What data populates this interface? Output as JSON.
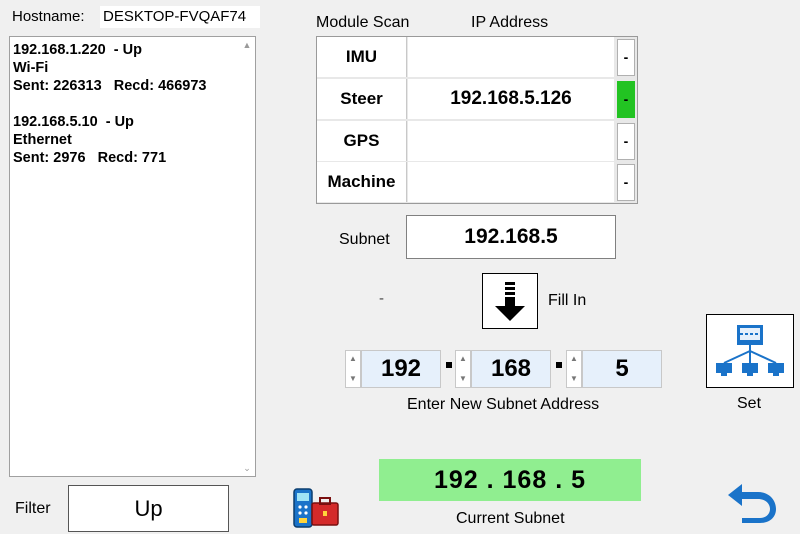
{
  "hostname": {
    "label": "Hostname:",
    "value": "DESKTOP-FVQAF74"
  },
  "networks": [
    {
      "address": "192.168.1.220  - Up",
      "type": "Wi-Fi",
      "traffic": "Sent: 226313   Recd: 466973"
    },
    {
      "address": "192.168.5.10  - Up",
      "type": "Ethernet",
      "traffic": "Sent: 2976   Recd: 771"
    }
  ],
  "filter": {
    "label": "Filter",
    "value": "Up"
  },
  "module_table": {
    "col_module": "Module Scan",
    "col_ip": "IP Address",
    "rows": [
      {
        "name": "IMU",
        "ip": "",
        "status": "-",
        "status_color": "#ffffff"
      },
      {
        "name": "Steer",
        "ip": "192.168.5.126",
        "status": "-",
        "status_color": "#22c322"
      },
      {
        "name": "GPS",
        "ip": "",
        "status": "-",
        "status_color": "#ffffff"
      },
      {
        "name": "Machine",
        "ip": "",
        "status": "-",
        "status_color": "#ffffff"
      }
    ]
  },
  "subnet": {
    "label": "Subnet",
    "value": "192.168.5"
  },
  "fill_in": {
    "dash": "-",
    "label": "Fill In"
  },
  "new_subnet": {
    "octets": [
      "192",
      "168",
      "5"
    ],
    "label": "Enter New Subnet Address"
  },
  "set": {
    "label": "Set"
  },
  "current_subnet": {
    "value": "192 . 168 . 5",
    "label": "Current Subnet"
  },
  "colors": {
    "accent_blue": "#1a73c9",
    "ok_green": "#22c322",
    "current_bg": "#90ee90"
  },
  "icons": [
    "fill-in-arrow-icon",
    "network-set-icon",
    "tool-case-icon",
    "back-arrow-icon"
  ]
}
